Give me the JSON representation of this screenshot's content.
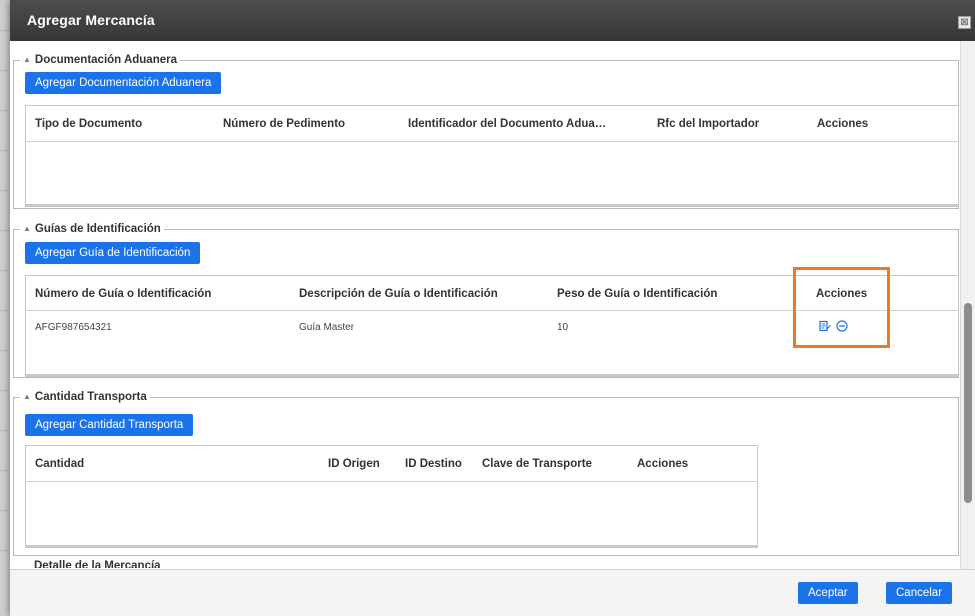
{
  "dialog": {
    "title": "Agregar Mercancía",
    "close_glyph": "⊠"
  },
  "documentacion": {
    "legend": "Documentación Aduanera",
    "add_button": "Agregar Documentación Aduanera",
    "columns": [
      "Tipo de Documento",
      "Número de Pedimento",
      "Identificador del Documento Adua…",
      "Rfc del Importador",
      "Acciones"
    ],
    "rows": []
  },
  "guias": {
    "legend": "Guías de Identificación",
    "add_button": "Agregar Guía de Identificación",
    "columns": [
      "Número de Guía o Identificación",
      "Descripción de Guía o Identificación",
      "Peso de Guía o Identificación",
      "Acciones"
    ],
    "rows": [
      {
        "numero": "AFGF987654321",
        "descripcion": "Guía Master",
        "peso": "10",
        "actions": [
          "edit-icon",
          "remove-icon"
        ]
      }
    ]
  },
  "cantidad": {
    "legend": "Cantidad Transporta",
    "add_button": "Agregar Cantidad Transporta",
    "columns": [
      "Cantidad",
      "ID Origen",
      "ID Destino",
      "Clave de Transporte",
      "Acciones"
    ],
    "rows": []
  },
  "next_section_peek": "Detalle de la Mercancía",
  "footer": {
    "accept_label": "Aceptar",
    "cancel_label": "Cancelar"
  },
  "colors": {
    "button_blue": "#1a73e8",
    "highlight_orange": "#ec7a2c",
    "titlebar": "#3f3f3f"
  },
  "icons": {
    "section_caret": "▲",
    "edit": "edit-icon",
    "remove": "remove-icon"
  }
}
